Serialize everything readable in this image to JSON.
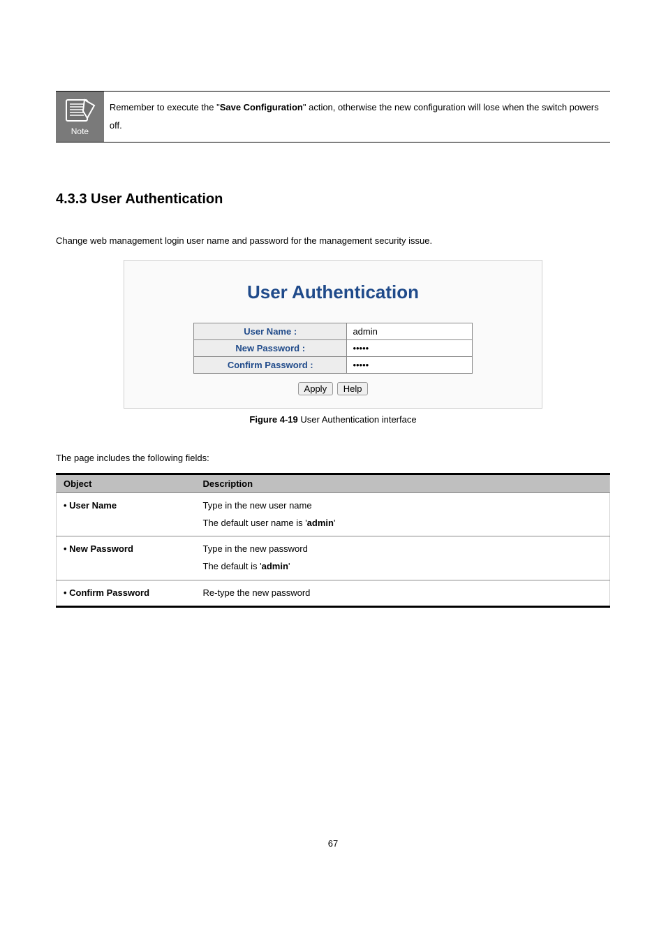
{
  "note": {
    "label": "Note",
    "text_prefix": "Remember to execute the \"",
    "text_bold": "Save Configuration",
    "text_middle": "\" action, otherwise the new configuration will lose when the switch powers off."
  },
  "section": {
    "heading": "4.3.3 User Authentication",
    "desc": "Change web management login user name and password for the management security issue."
  },
  "auth": {
    "title": "User Authentication",
    "rows": {
      "username_label": "User Name :",
      "username_value": "admin",
      "newpass_label": "New Password :",
      "newpass_value": "•••••",
      "confirmpass_label": "Confirm Password :",
      "confirmpass_value": "•••••"
    },
    "buttons": {
      "apply": "Apply",
      "help": "Help"
    }
  },
  "caption": {
    "figlbl": "Figure 4-19",
    "text": " User Authentication interface"
  },
  "fields_intro": "The page includes the following fields:",
  "fields_table": {
    "headers": {
      "object": "Object",
      "description": "Description"
    },
    "rows": [
      {
        "object": "• User Name",
        "desc_line1": "Type in the new user name",
        "desc_line2_pre": "The default user name is '",
        "desc_line2_bold": "admin",
        "desc_line2_post": "'"
      },
      {
        "object": "• New Password",
        "desc_line1": "Type in the new password",
        "desc_line2_pre": "The default is '",
        "desc_line2_bold": "admin",
        "desc_line2_post": "'"
      },
      {
        "object": "• Confirm Password",
        "desc_line1": "Re-type the new password",
        "desc_line2_pre": "",
        "desc_line2_bold": "",
        "desc_line2_post": ""
      }
    ]
  },
  "page_number": "67"
}
